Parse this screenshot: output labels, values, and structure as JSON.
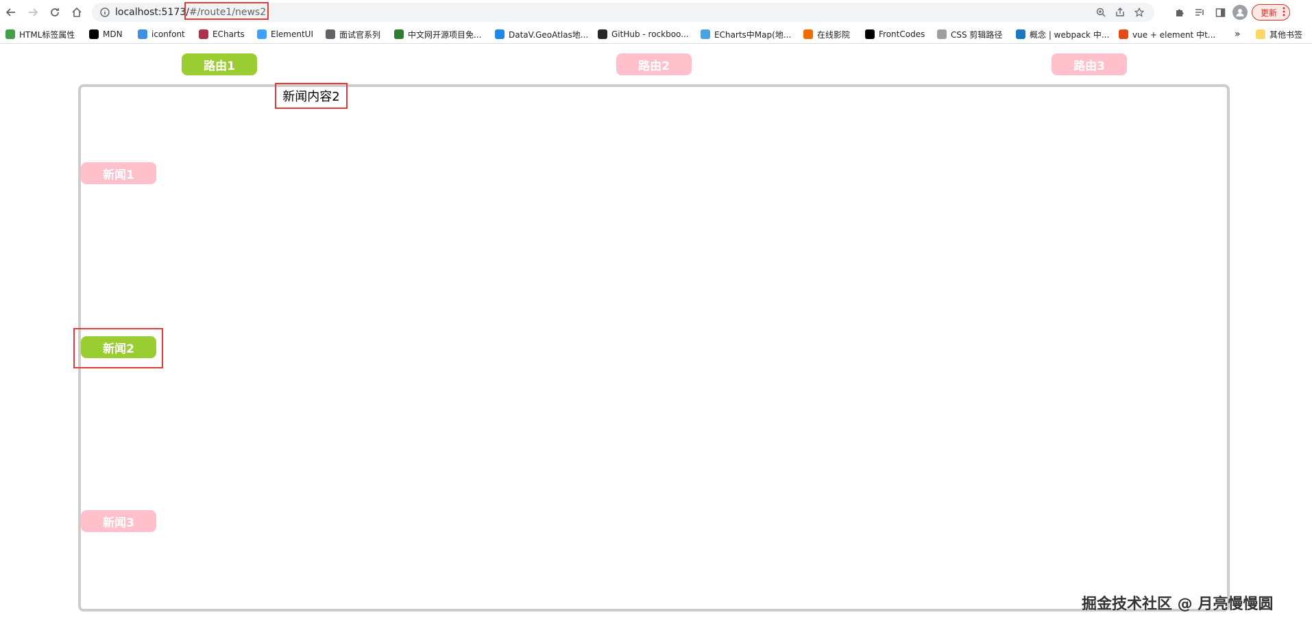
{
  "browser": {
    "url_host": "localhost:5173/",
    "url_hash": "#/route1/news2",
    "update_label": "更新",
    "bookmarks": [
      {
        "label": "HTML标签属性",
        "color": "#43a047"
      },
      {
        "label": "MDN",
        "color": "#000000"
      },
      {
        "label": "iconfont",
        "color": "#3f8fe0"
      },
      {
        "label": "ECharts",
        "color": "#aa344d"
      },
      {
        "label": "ElementUI",
        "color": "#409eff"
      },
      {
        "label": "面试官系列",
        "color": "#5f6368"
      },
      {
        "label": "中文网开源项目免...",
        "color": "#2e7d32"
      },
      {
        "label": "DataV.GeoAtlas地...",
        "color": "#1e88e5"
      },
      {
        "label": "GitHub - rockboo...",
        "color": "#24292e"
      },
      {
        "label": "ECharts中Map(地...",
        "color": "#4aa3df"
      },
      {
        "label": "在线影院",
        "color": "#ef6c00"
      },
      {
        "label": "FrontCodes",
        "color": "#000000"
      },
      {
        "label": "CSS 剪辑路径",
        "color": "#9e9e9e"
      },
      {
        "label": "概念 | webpack 中...",
        "color": "#1c78c0"
      },
      {
        "label": "vue + element 中t...",
        "color": "#e64a19"
      }
    ],
    "more_label": "»",
    "other_bookmarks": "其他书签"
  },
  "routes": [
    {
      "label": "路由1",
      "active": true
    },
    {
      "label": "路由2",
      "active": false
    },
    {
      "label": "路由3",
      "active": false
    }
  ],
  "news_content": "新闻内容2",
  "news": [
    {
      "label": "新闻1",
      "active": false
    },
    {
      "label": "新闻2",
      "active": true
    },
    {
      "label": "新闻3",
      "active": false
    }
  ],
  "colors": {
    "active": "#9acd32",
    "inactive": "#ffc0cb",
    "highlight": "#e53935"
  },
  "watermark": "掘金技术社区 @ 月亮慢慢圆"
}
